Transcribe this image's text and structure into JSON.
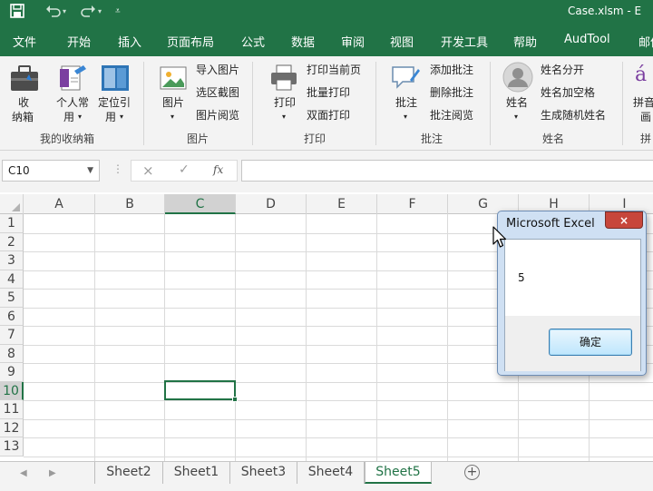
{
  "title_bar": {
    "save_icon": "save-icon",
    "undo_icon": "undo-icon",
    "redo_icon": "redo-icon",
    "customize_icon": "customize-qat-icon",
    "title": "Case.xlsm - E"
  },
  "menu": {
    "tabs": [
      "文件",
      "开始",
      "插入",
      "页面布局",
      "公式",
      "数据",
      "审阅",
      "视图",
      "开发工具",
      "帮助",
      "AudTool",
      "邮件"
    ]
  },
  "ribbon": {
    "my_toolbox": {
      "group_label": "我的收纳箱",
      "storage_button": [
        "收",
        "纳箱"
      ],
      "personal_button": [
        "个人常",
        "用"
      ],
      "locate_button": [
        "定位引",
        "用"
      ]
    },
    "picture": {
      "group_label": "图片",
      "picture_button": "图片",
      "import_picture": "导入图片",
      "region_screenshot": "选区截图",
      "picture_browse": "图片阅览"
    },
    "print": {
      "group_label": "打印",
      "print_button": "打印",
      "print_current_page": "打印当前页",
      "batch_print": "批量打印",
      "duplex_print": "双面打印"
    },
    "comment": {
      "group_label": "批注",
      "comment_button": "批注",
      "add_comment": "添加批注",
      "delete_comment": "删除批注",
      "comment_browse": "批注阅览"
    },
    "name": {
      "group_label": "姓名",
      "name_button": "姓名",
      "split_name": "姓名分开",
      "name_add_space": "姓名加空格",
      "random_name": "生成随机姓名"
    },
    "pinyin": {
      "group_label": "拼",
      "pinyin_button": [
        "拼音",
        "画"
      ]
    }
  },
  "formula_bar": {
    "name_box": "C10",
    "cancel_icon": "×",
    "enter_icon": "✓",
    "fx_label": "fx",
    "formula_value": ""
  },
  "grid": {
    "columns": [
      "A",
      "B",
      "C",
      "D",
      "E",
      "F",
      "G",
      "H",
      "I"
    ],
    "rows": [
      "1",
      "2",
      "3",
      "4",
      "5",
      "6",
      "7",
      "8",
      "9",
      "10",
      "11",
      "12",
      "13"
    ],
    "selected_column": "C",
    "selected_row": "10"
  },
  "sheets": {
    "tabs": [
      "Sheet2",
      "Sheet1",
      "Sheet3",
      "Sheet4",
      "Sheet5"
    ],
    "active": "Sheet5",
    "add_label": "+"
  },
  "dialog": {
    "title": "Microsoft Excel",
    "close_label": "×",
    "message": "5",
    "ok_label": "确定"
  },
  "colors": {
    "excel_green": "#217346",
    "dialog_close_red": "#c7463b",
    "dialog_ok_blue": "#bee6fd"
  }
}
